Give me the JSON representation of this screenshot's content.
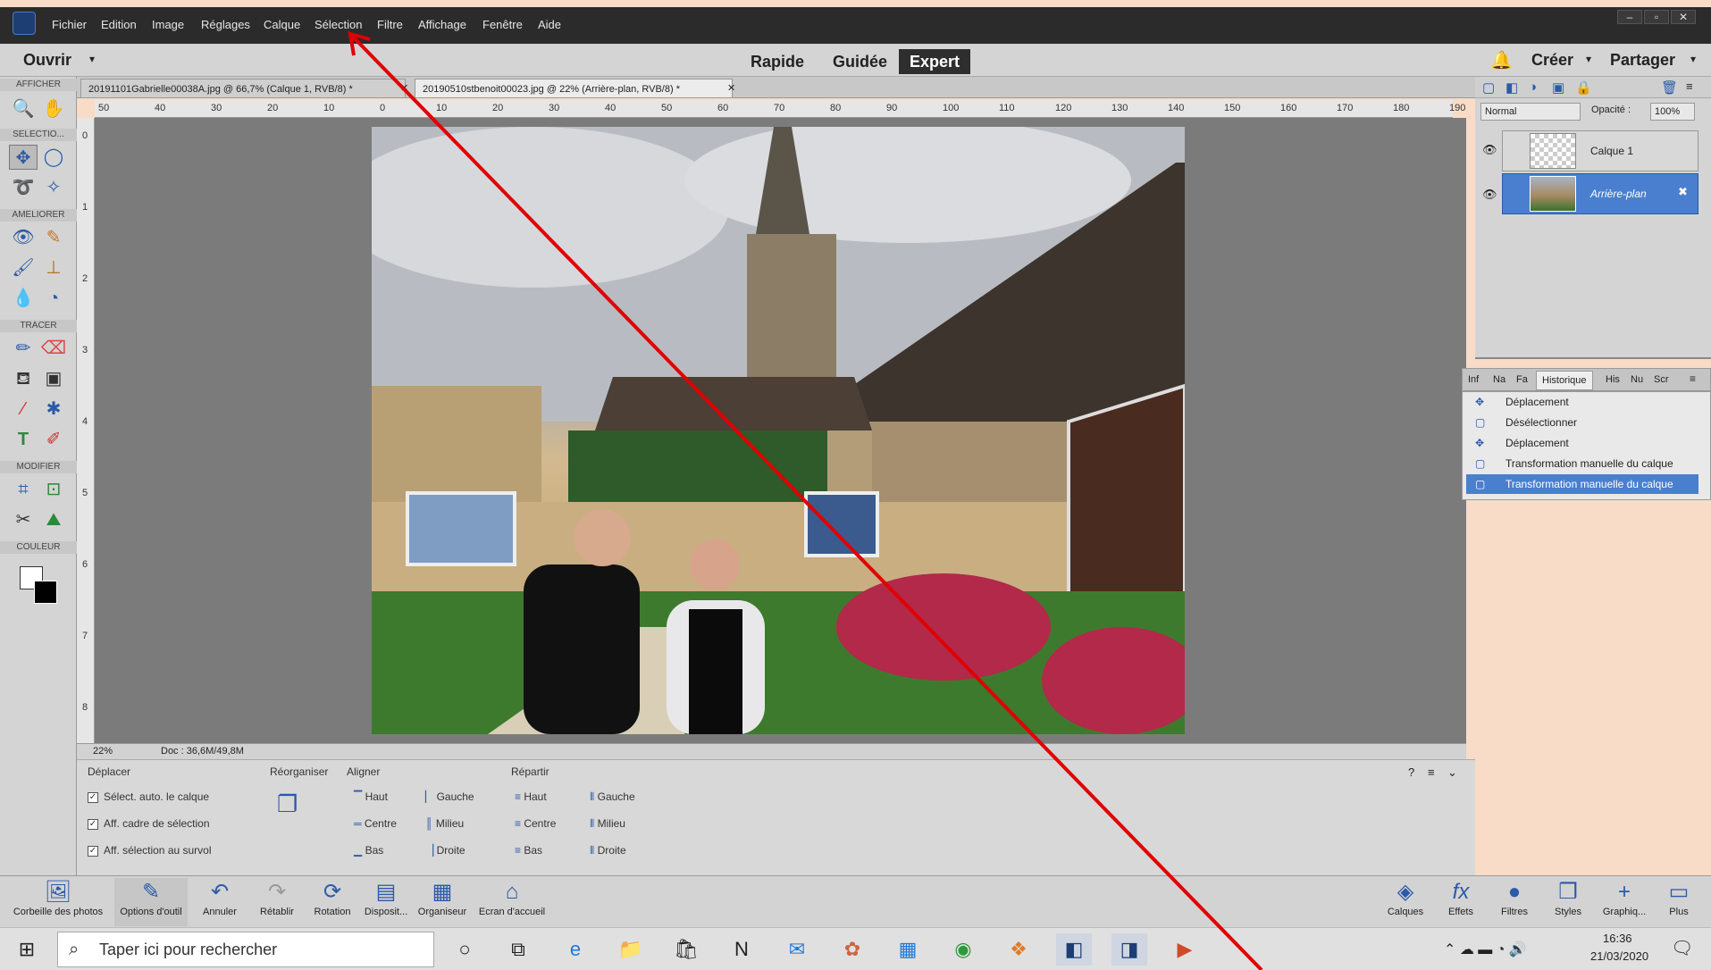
{
  "titlebar": {
    "menus": [
      "Fichier",
      "Edition",
      "Image",
      "Réglages",
      "Calque",
      "Sélection",
      "Filtre",
      "Affichage",
      "Fenêtre",
      "Aide"
    ]
  },
  "window_controls": [
    "–",
    "▫",
    "✕"
  ],
  "modebar": {
    "open_label": "Ouvrir",
    "tabs": [
      "Rapide",
      "Guidée",
      "Expert"
    ],
    "active_tab": "Expert",
    "create_label": "Créer",
    "share_label": "Partager"
  },
  "toolbox": {
    "sections": [
      "AFFICHER",
      "SELECTIO...",
      "AMELIORER",
      "TRACER",
      "MODIFIER",
      "COULEUR"
    ]
  },
  "documents": [
    {
      "name": "20191101Gabrielle00038A.jpg @ 66,7% (Calque 1, RVB/8) *"
    },
    {
      "name": "20190510stbenoit00023.jpg @ 22% (Arrière-plan, RVB/8) *"
    }
  ],
  "ruler": {
    "h": [
      "50",
      "40",
      "30",
      "20",
      "10",
      "0",
      "10",
      "20",
      "30",
      "40",
      "50",
      "60",
      "70",
      "80",
      "90",
      "100",
      "110",
      "120",
      "130",
      "140",
      "150",
      "160",
      "170",
      "180",
      "190"
    ],
    "v": [
      "0",
      "1",
      "2",
      "3",
      "4",
      "5",
      "6",
      "7",
      "8"
    ]
  },
  "status": {
    "zoom": "22%",
    "doc": "Doc : 36,6M/49,8M"
  },
  "options": {
    "title": "Déplacer",
    "checks": [
      "Sélect. auto. le calque",
      "Aff. cadre de sélection",
      "Aff. sélection au survol"
    ],
    "reorganiser": "Réorganiser",
    "aligner": "Aligner",
    "align_items": [
      "Haut",
      "Gauche",
      "Centre",
      "Milieu",
      "Bas",
      "Droite"
    ],
    "repartir": "Répartir",
    "repartir_items": [
      "Haut",
      "Gauche",
      "Centre",
      "Milieu",
      "Bas",
      "Droite"
    ]
  },
  "layers": {
    "blend": "Normal",
    "opacity_label": "Opacité :",
    "opacity": "100%",
    "items": [
      "Calque 1",
      "Arrière-plan"
    ]
  },
  "history": {
    "tabs": [
      "Inf",
      "Na",
      "Fa",
      "Historique",
      "His",
      "Nu",
      "Scr"
    ],
    "items": [
      "Déplacement",
      "Désélectionner",
      "Déplacement",
      "Transformation manuelle du calque",
      "Transformation manuelle du calque"
    ]
  },
  "bottombar": {
    "left": [
      "Corbeille des photos",
      "Options d'outil",
      "Annuler",
      "Rétablir",
      "Rotation",
      "Disposit...",
      "Organiseur",
      "Ecran d'accueil"
    ],
    "right": [
      "Calques",
      "Effets",
      "Filtres",
      "Styles",
      "Graphiq...",
      "Plus"
    ]
  },
  "taskbar": {
    "search_placeholder": "Taper ici pour rechercher",
    "time": "16:36",
    "date": "21/03/2020"
  },
  "accent": "#2a5aa8",
  "annotation_color": "#e00000"
}
